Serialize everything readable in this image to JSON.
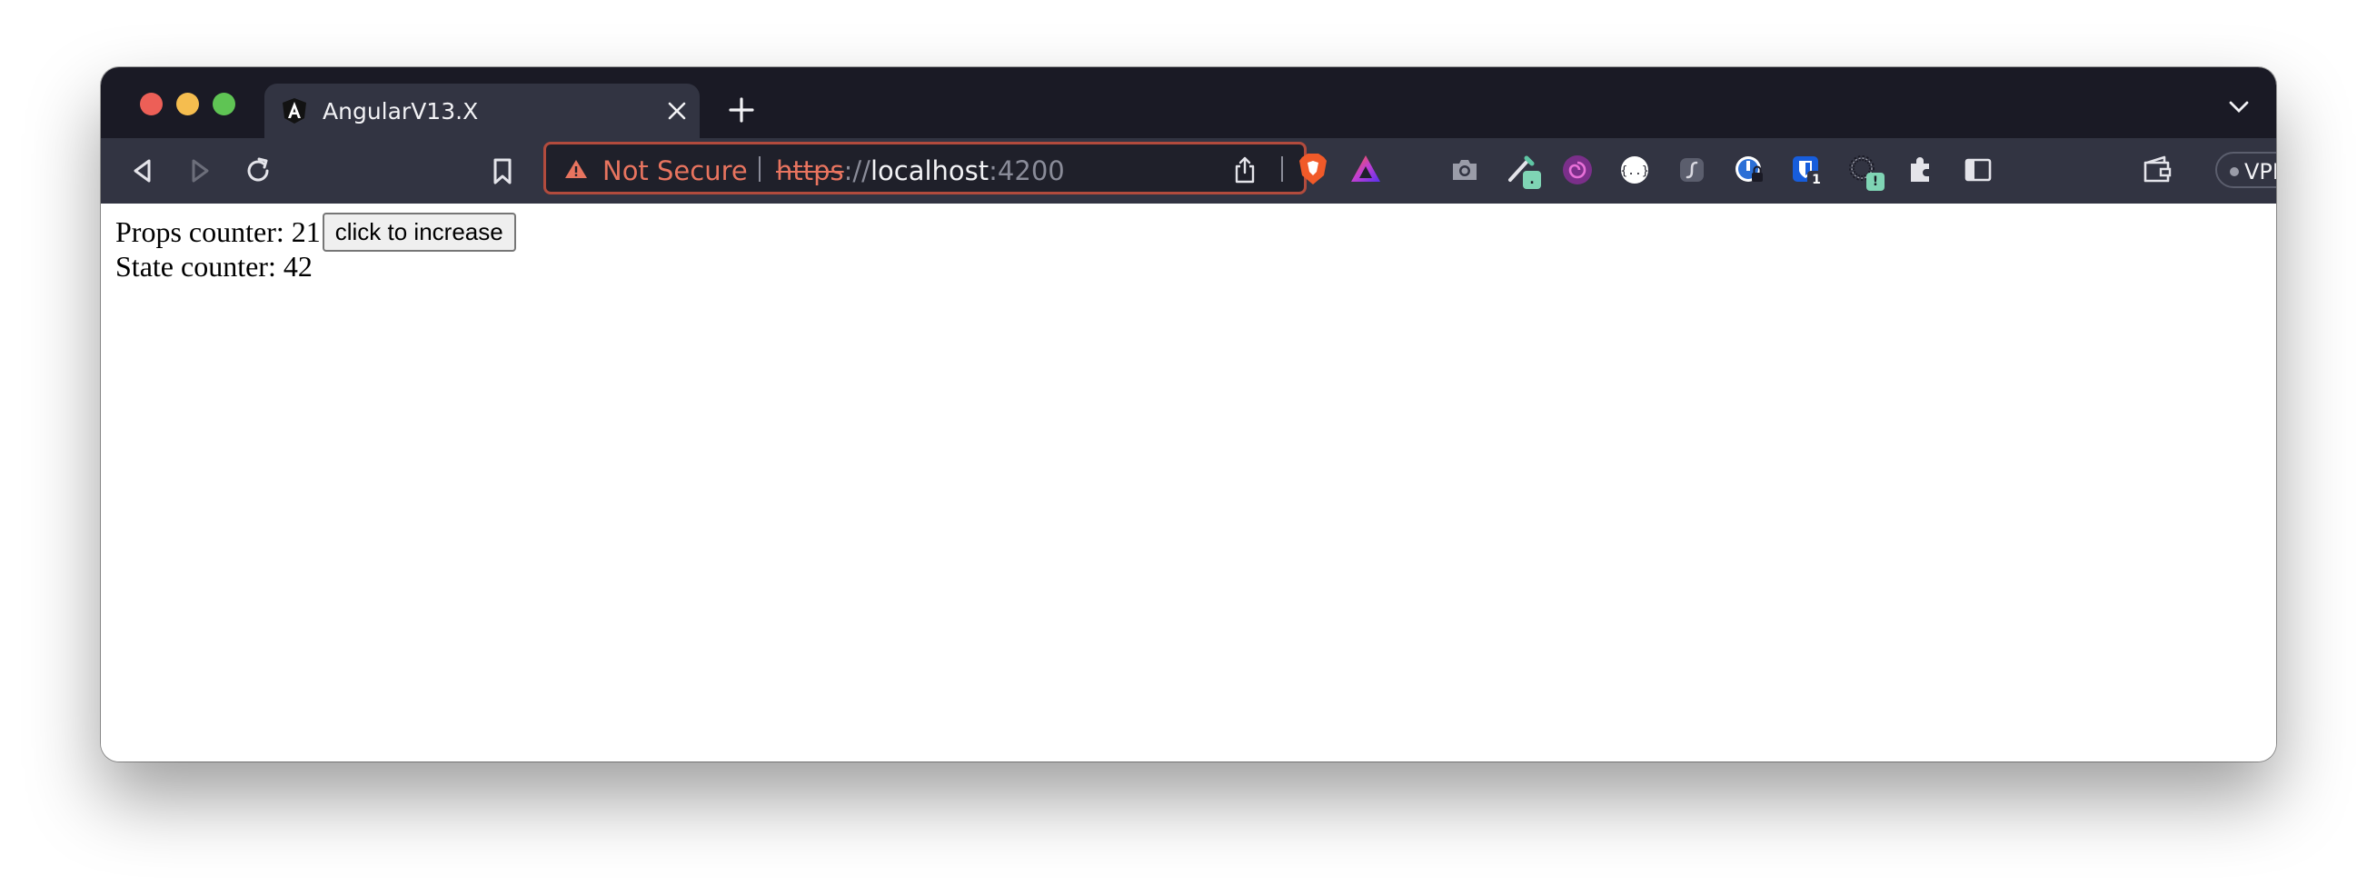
{
  "tab": {
    "title": "AngularV13.X",
    "favicon": "angular-icon"
  },
  "address_bar": {
    "security_label": "Not Secure",
    "url_scheme": "https",
    "url_separator": "://",
    "url_host": "localhost",
    "url_port": ":4200"
  },
  "toolbar": {
    "extensions": [
      "camera-icon",
      "pen-icon",
      "spiral-icon",
      "json-icon",
      "script-icon",
      "lock-icon",
      "bitwarden-icon",
      "spinner-icon",
      "puzzle-icon",
      "sidebar-icon",
      "wallet-icon"
    ],
    "pen_badge": ".",
    "bitwarden_badge": "1",
    "spinner_badge": "!",
    "vpn_label": "VPN"
  },
  "page": {
    "props_label": "Props counter: ",
    "props_value": "21",
    "button_label": "click to increase",
    "state_label": "State counter: ",
    "state_value": "42"
  },
  "colors": {
    "tabbar": "#1a1a25",
    "toolbar": "#323442",
    "warning": "#e8745f",
    "url_border": "#b24b3d"
  }
}
